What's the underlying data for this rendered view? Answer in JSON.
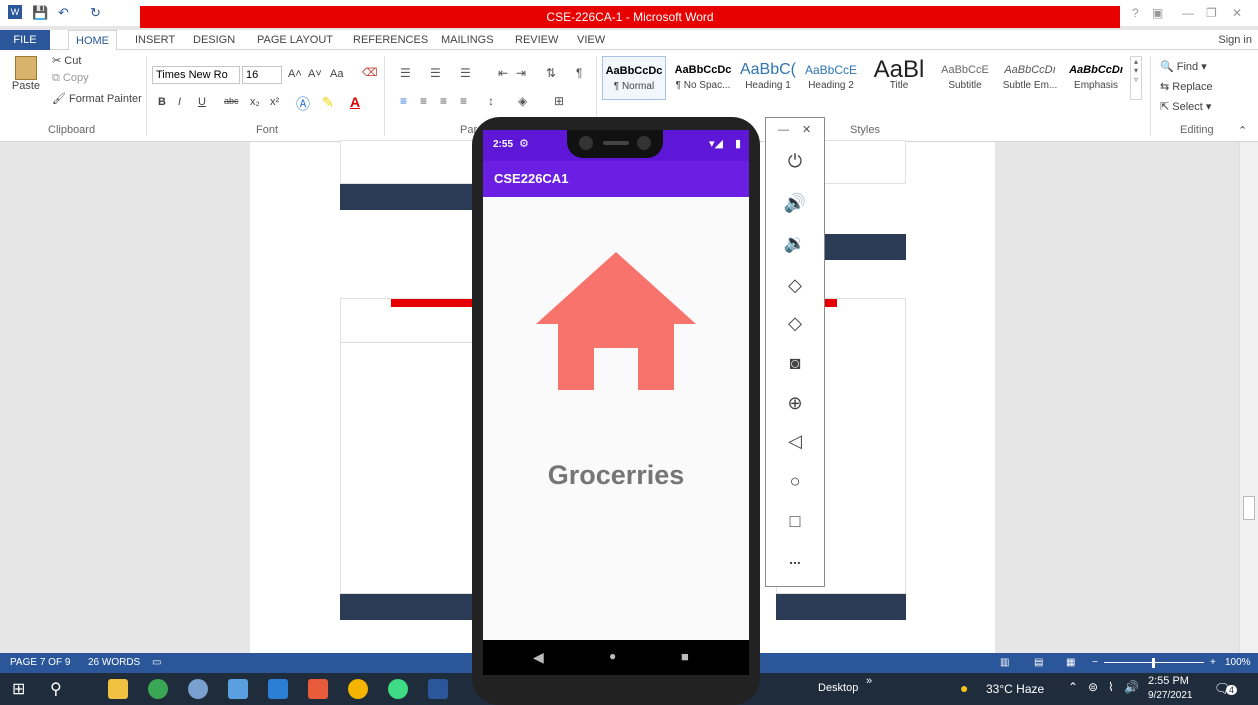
{
  "window": {
    "title": "CSE-226CA-1 - Microsoft Word",
    "help": "?",
    "minimize": "—",
    "restore": "❐",
    "close": "✕"
  },
  "quick_access": {
    "save": "💾",
    "undo": "↶",
    "redo": "↻"
  },
  "tabs": [
    "FILE",
    "HOME",
    "INSERT",
    "DESIGN",
    "PAGE LAYOUT",
    "REFERENCES",
    "MAILINGS",
    "REVIEW",
    "VIEW"
  ],
  "signin": "Sign in",
  "ribbon": {
    "clipboard": {
      "paste": "Paste",
      "cut": "Cut",
      "copy": "Copy",
      "format_painter": "Format Painter",
      "label": "Clipboard"
    },
    "font": {
      "name": "Times New Ro",
      "size": "16",
      "label": "Font",
      "bold": "B",
      "italic": "I",
      "underline": "U",
      "strike": "abc",
      "sub": "x₂",
      "sup": "x²",
      "grow": "A˄",
      "shrink": "A˅",
      "case": "Aa"
    },
    "paragraph": {
      "label": "Par"
    },
    "styles": {
      "label": "Styles",
      "items": [
        {
          "sample": "AaBbCcDc",
          "name": "¶ Normal"
        },
        {
          "sample": "AaBbCcDc",
          "name": "¶ No Spac..."
        },
        {
          "sample": "AaBbC(",
          "name": "Heading 1"
        },
        {
          "sample": "AaBbCcE",
          "name": "Heading 2"
        },
        {
          "sample": "AaBl",
          "name": "Title"
        },
        {
          "sample": "AaBbCcE",
          "name": "Subtitle"
        },
        {
          "sample": "AaBbCcDı",
          "name": "Subtle Em..."
        },
        {
          "sample": "AaBbCcDı",
          "name": "Emphasis"
        }
      ]
    },
    "editing": {
      "label": "Editing",
      "find": "Find",
      "replace": "Replace",
      "select": "Select"
    }
  },
  "status": {
    "page": "PAGE 7 OF 9",
    "words": "26 WORDS",
    "zoom": "100%"
  },
  "taskbar": {
    "desktop": "Desktop",
    "weather": "33°C Haze",
    "time": "2:55 PM",
    "date": "9/27/2021",
    "notif": "4",
    "chevron": "»"
  },
  "phone": {
    "time": "2:55",
    "app_title": "CSE226CA1",
    "label": "Grocerries"
  },
  "emulator": {
    "min": "—",
    "close": "✕",
    "more": "..."
  }
}
